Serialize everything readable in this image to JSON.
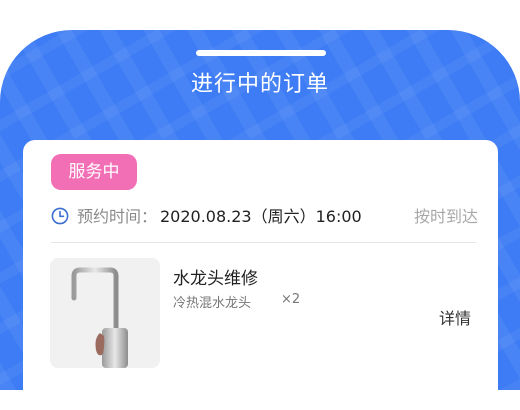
{
  "header": {
    "title": "进行中的订单"
  },
  "order": {
    "status_badge": "服务中",
    "time_label": "预约时间：",
    "time_value": "2020.08.23（周六）16:00",
    "time_status": "按时到达",
    "item": {
      "name": "水龙头维修",
      "spec": "冷热混水龙头",
      "quantity": "×2",
      "detail_link": "详情",
      "image": "faucet-image"
    }
  },
  "colors": {
    "header_bg": "#3d7cf4",
    "badge_bg": "#f26fb5",
    "clock_icon": "#3d6fd1"
  }
}
